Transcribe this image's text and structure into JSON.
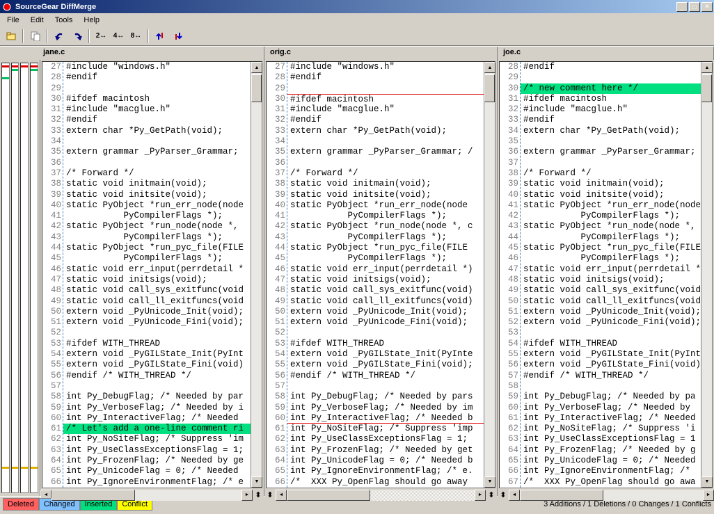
{
  "window": {
    "title": "SourceGear DiffMerge"
  },
  "menu": {
    "file": "File",
    "edit": "Edit",
    "tools": "Tools",
    "help": "Help"
  },
  "toolbar": {
    "b1": "2↔",
    "b2": "4↔",
    "b3": "8↔"
  },
  "files": {
    "left": "jane.c",
    "center": "orig.c",
    "right": "joe.c"
  },
  "legend": {
    "deleted": "Deleted",
    "changed": "Changed",
    "inserted": "Inserted",
    "conflict": "Conflict"
  },
  "status": "3 Additions / 1 Deletions / 0 Changes / 1 Conflicts",
  "panes": {
    "left": {
      "start": 27,
      "lines": [
        {
          "n": 27,
          "t": "#include \"windows.h\""
        },
        {
          "n": 28,
          "t": "#endif"
        },
        {
          "n": 29,
          "t": ""
        },
        {
          "n": 30,
          "t": "#ifdef macintosh"
        },
        {
          "n": 31,
          "t": "#include \"macglue.h\""
        },
        {
          "n": 32,
          "t": "#endif"
        },
        {
          "n": 33,
          "t": "extern char *Py_GetPath(void);"
        },
        {
          "n": 34,
          "t": ""
        },
        {
          "n": 35,
          "t": "extern grammar _PyParser_Grammar;"
        },
        {
          "n": 36,
          "t": ""
        },
        {
          "n": 37,
          "t": "/* Forward */"
        },
        {
          "n": 38,
          "t": "static void initmain(void);"
        },
        {
          "n": 39,
          "t": "static void initsite(void);"
        },
        {
          "n": 40,
          "t": "static PyObject *run_err_node(node"
        },
        {
          "n": 41,
          "t": "           PyCompilerFlags *);"
        },
        {
          "n": 42,
          "t": "static PyObject *run_node(node *, "
        },
        {
          "n": 43,
          "t": "           PyCompilerFlags *);"
        },
        {
          "n": 44,
          "t": "static PyObject *run_pyc_file(FILE"
        },
        {
          "n": 45,
          "t": "           PyCompilerFlags *);"
        },
        {
          "n": 46,
          "t": "static void err_input(perrdetail *"
        },
        {
          "n": 47,
          "t": "static void initsigs(void);"
        },
        {
          "n": 48,
          "t": "static void call_sys_exitfunc(void"
        },
        {
          "n": 49,
          "t": "static void call_ll_exitfuncs(void"
        },
        {
          "n": 50,
          "t": "extern void _PyUnicode_Init(void);"
        },
        {
          "n": 51,
          "t": "extern void _PyUnicode_Fini(void);"
        },
        {
          "n": 52,
          "t": ""
        },
        {
          "n": 53,
          "t": "#ifdef WITH_THREAD"
        },
        {
          "n": 54,
          "t": "extern void _PyGILState_Init(PyInt"
        },
        {
          "n": 55,
          "t": "extern void _PyGILState_Fini(void)"
        },
        {
          "n": 56,
          "t": "#endif /* WITH_THREAD */"
        },
        {
          "n": 57,
          "t": ""
        },
        {
          "n": 58,
          "t": "int Py_DebugFlag; /* Needed by par"
        },
        {
          "n": 59,
          "t": "int Py_VerboseFlag; /* Needed by i"
        },
        {
          "n": 60,
          "t": "int Py_InteractiveFlag; /* Needed "
        },
        {
          "n": 61,
          "t": "/* Let's add a one-line comment ri",
          "hl": "green"
        },
        {
          "n": 62,
          "t": "int Py_NoSiteFlag; /* Suppress 'im"
        },
        {
          "n": 63,
          "t": "int Py_UseClassExceptionsFlag = 1;"
        },
        {
          "n": 64,
          "t": "int Py_FrozenFlag; /* Needed by ge"
        },
        {
          "n": 65,
          "t": "int Py_UnicodeFlag = 0; /* Needed "
        },
        {
          "n": 66,
          "t": "int Py_IgnoreEnvironmentFlag; /* e"
        }
      ]
    },
    "center": {
      "start": 27,
      "lines": [
        {
          "n": 27,
          "t": "#include \"windows.h\""
        },
        {
          "n": 28,
          "t": "#endif"
        },
        {
          "n": 29,
          "t": ""
        },
        {
          "n": 30,
          "t": "#ifdef macintosh",
          "redtop": true
        },
        {
          "n": 31,
          "t": "#include \"macglue.h\""
        },
        {
          "n": 32,
          "t": "#endif"
        },
        {
          "n": 33,
          "t": "extern char *Py_GetPath(void);"
        },
        {
          "n": 34,
          "t": ""
        },
        {
          "n": 35,
          "t": "extern grammar _PyParser_Grammar; /"
        },
        {
          "n": 36,
          "t": ""
        },
        {
          "n": 37,
          "t": "/* Forward */"
        },
        {
          "n": 38,
          "t": "static void initmain(void);"
        },
        {
          "n": 39,
          "t": "static void initsite(void);"
        },
        {
          "n": 40,
          "t": "static PyObject *run_err_node(node "
        },
        {
          "n": 41,
          "t": "           PyCompilerFlags *);"
        },
        {
          "n": 42,
          "t": "static PyObject *run_node(node *, c"
        },
        {
          "n": 43,
          "t": "           PyCompilerFlags *);"
        },
        {
          "n": 44,
          "t": "static PyObject *run_pyc_file(FILE "
        },
        {
          "n": 45,
          "t": "           PyCompilerFlags *);"
        },
        {
          "n": 46,
          "t": "static void err_input(perrdetail *)"
        },
        {
          "n": 47,
          "t": "static void initsigs(void);"
        },
        {
          "n": 48,
          "t": "static void call_sys_exitfunc(void)"
        },
        {
          "n": 49,
          "t": "static void call_ll_exitfuncs(void)"
        },
        {
          "n": 50,
          "t": "extern void _PyUnicode_Init(void);"
        },
        {
          "n": 51,
          "t": "extern void _PyUnicode_Fini(void);"
        },
        {
          "n": 52,
          "t": ""
        },
        {
          "n": 53,
          "t": "#ifdef WITH_THREAD"
        },
        {
          "n": 54,
          "t": "extern void _PyGILState_Init(PyInte"
        },
        {
          "n": 55,
          "t": "extern void _PyGILState_Fini(void);"
        },
        {
          "n": 56,
          "t": "#endif /* WITH_THREAD */"
        },
        {
          "n": 57,
          "t": ""
        },
        {
          "n": 58,
          "t": "int Py_DebugFlag; /* Needed by pars"
        },
        {
          "n": 59,
          "t": "int Py_VerboseFlag; /* Needed by im"
        },
        {
          "n": 60,
          "t": "int Py_InteractiveFlag; /* Needed b",
          "redbot": true
        },
        {
          "n": 61,
          "t": "int Py_NoSiteFlag; /* Suppress 'imp"
        },
        {
          "n": 62,
          "t": "int Py_UseClassExceptionsFlag = 1; "
        },
        {
          "n": 63,
          "t": "int Py_FrozenFlag; /* Needed by get"
        },
        {
          "n": 64,
          "t": "int Py_UnicodeFlag = 0; /* Needed b"
        },
        {
          "n": 65,
          "t": "int Py_IgnoreEnvironmentFlag; /* e."
        },
        {
          "n": 66,
          "t": "/*  XXX Py_OpenFlag should go away"
        }
      ]
    },
    "right": {
      "start": 28,
      "lines": [
        {
          "n": 28,
          "t": "#endif"
        },
        {
          "n": 29,
          "t": ""
        },
        {
          "n": 30,
          "t": "/* new comment here */",
          "hl": "green"
        },
        {
          "n": 31,
          "t": "#ifdef macintosh"
        },
        {
          "n": 32,
          "t": "#include \"macglue.h\""
        },
        {
          "n": 33,
          "t": "#endif"
        },
        {
          "n": 34,
          "t": "extern char *Py_GetPath(void);"
        },
        {
          "n": 35,
          "t": ""
        },
        {
          "n": 36,
          "t": "extern grammar _PyParser_Grammar;"
        },
        {
          "n": 37,
          "t": ""
        },
        {
          "n": 38,
          "t": "/* Forward */"
        },
        {
          "n": 39,
          "t": "static void initmain(void);"
        },
        {
          "n": 40,
          "t": "static void initsite(void);"
        },
        {
          "n": 41,
          "t": "static PyObject *run_err_node(node"
        },
        {
          "n": 42,
          "t": "           PyCompilerFlags *);"
        },
        {
          "n": 43,
          "t": "static PyObject *run_node(node *, "
        },
        {
          "n": 44,
          "t": "           PyCompilerFlags *);"
        },
        {
          "n": 45,
          "t": "static PyObject *run_pyc_file(FILE"
        },
        {
          "n": 46,
          "t": "           PyCompilerFlags *);"
        },
        {
          "n": 47,
          "t": "static void err_input(perrdetail *"
        },
        {
          "n": 48,
          "t": "static void initsigs(void);"
        },
        {
          "n": 49,
          "t": "static void call_sys_exitfunc(void"
        },
        {
          "n": 50,
          "t": "static void call_ll_exitfuncs(void"
        },
        {
          "n": 51,
          "t": "extern void _PyUnicode_Init(void);"
        },
        {
          "n": 52,
          "t": "extern void _PyUnicode_Fini(void);"
        },
        {
          "n": 53,
          "t": ""
        },
        {
          "n": 54,
          "t": "#ifdef WITH_THREAD"
        },
        {
          "n": 55,
          "t": "extern void _PyGILState_Init(PyInt"
        },
        {
          "n": 56,
          "t": "extern void _PyGILState_Fini(void)"
        },
        {
          "n": 57,
          "t": "#endif /* WITH_THREAD */"
        },
        {
          "n": 58,
          "t": ""
        },
        {
          "n": 59,
          "t": "int Py_DebugFlag; /* Needed by pa"
        },
        {
          "n": 60,
          "t": "int Py_VerboseFlag; /* Needed by "
        },
        {
          "n": 61,
          "t": "int Py_InteractiveFlag; /* Needed"
        },
        {
          "n": 62,
          "t": "int Py_NoSiteFlag; /* Suppress 'i"
        },
        {
          "n": 63,
          "t": "int Py_UseClassExceptionsFlag = 1"
        },
        {
          "n": 64,
          "t": "int Py_FrozenFlag; /* Needed by g"
        },
        {
          "n": 65,
          "t": "int Py_UnicodeFlag = 0; /* Needed"
        },
        {
          "n": 66,
          "t": "int Py_IgnoreEnvironmentFlag; /* "
        },
        {
          "n": 67,
          "t": "/*  XXX Py_OpenFlag should go awa"
        }
      ]
    }
  }
}
